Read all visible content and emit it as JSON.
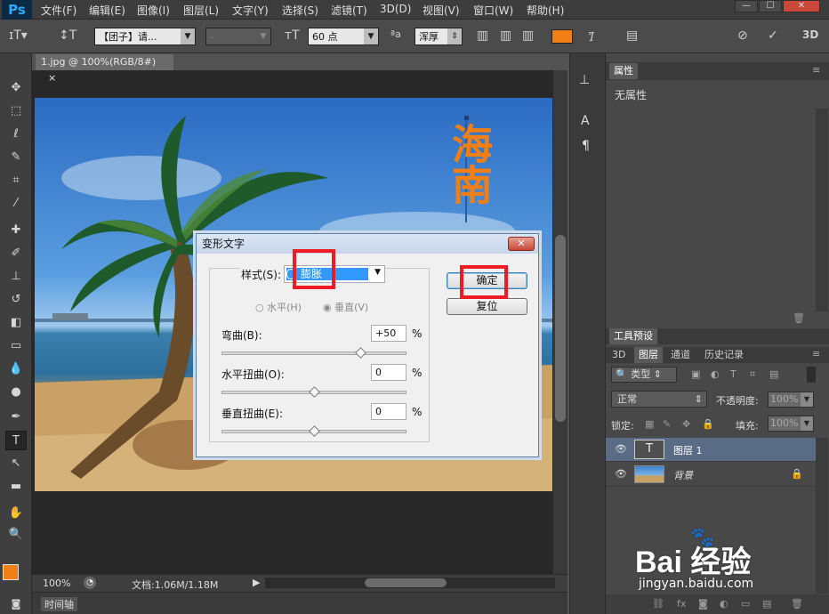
{
  "menubar": {
    "logo": "Ps",
    "items": [
      "文件(F)",
      "编辑(E)",
      "图像(I)",
      "图层(L)",
      "文字(Y)",
      "选择(S)",
      "滤镜(T)",
      "3D(D)",
      "视图(V)",
      "窗口(W)",
      "帮助(H)"
    ],
    "window_buttons": [
      "—",
      "☐",
      "✕"
    ]
  },
  "options": {
    "font_family": "【团子】请...",
    "font_style": "-",
    "font_size": "60 点",
    "aa_label": "ªa",
    "antialias": "浑厚",
    "text_color": "#f07f16",
    "three_d": "3D"
  },
  "document": {
    "tab_title": "1.jpg @ 100%(RGB/8#)",
    "tab_close": "×",
    "zoom": "100%",
    "doc_info": "文档:1.06M/1.18M",
    "timeline": "时间轴",
    "vertical_text": "海南",
    "vertical_text_color": "#f07f16"
  },
  "panels": {
    "properties": {
      "tab": "属性",
      "content": "无属性"
    },
    "tool_presets": {
      "tab": "工具预设"
    },
    "layer_tabs": [
      "3D",
      "图层",
      "通道",
      "历史记录"
    ],
    "filter_kind": "类型",
    "blend_mode": "正常",
    "opacity_label": "不透明度:",
    "opacity": "100%",
    "lock_label": "锁定:",
    "fill_label": "填充:",
    "fill": "100%",
    "layers": [
      {
        "name": "图层 1",
        "type": "T",
        "selected": true
      },
      {
        "name": "背景",
        "type": "image",
        "locked": true
      }
    ]
  },
  "dialog": {
    "title": "变形文字",
    "close": "✕",
    "style_label": "样式(S):",
    "style_value": "膨胀",
    "horizontal_label": "水平(H)",
    "vertical_label": "垂直(V)",
    "orientation": "vertical",
    "bend_label": "弯曲(B):",
    "bend_value": "+50",
    "bend_fraction": 0.75,
    "h_distort_label": "水平扭曲(O):",
    "h_distort_value": "0",
    "h_distort_fraction": 0.5,
    "v_distort_label": "垂直扭曲(E):",
    "v_distort_value": "0",
    "v_distort_fraction": 0.5,
    "percent": "%",
    "ok_label": "确定",
    "reset_label": "复位"
  },
  "watermark": {
    "brand": "Bai 经验",
    "url": "jingyan.baidu.com"
  }
}
